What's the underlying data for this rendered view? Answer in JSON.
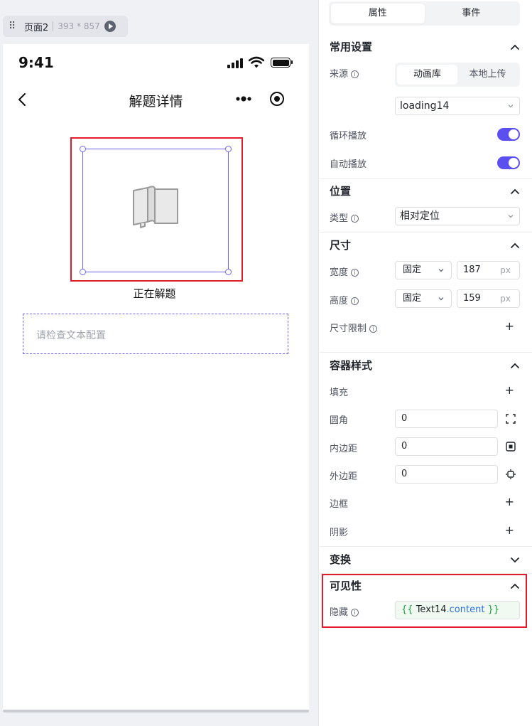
{
  "canvas": {
    "page_tag": {
      "name": "页面2",
      "size": "393 * 857"
    },
    "phone": {
      "time": "9:41",
      "nav_title": "解题详情",
      "loading_label": "正在解题",
      "text_placeholder": "请检查文本配置"
    }
  },
  "panel": {
    "tabs": [
      {
        "label": "属性",
        "active": true
      },
      {
        "label": "事件",
        "active": false
      }
    ],
    "common": {
      "title": "常用设置",
      "source_label": "来源",
      "source_options": [
        "动画库",
        "本地上传"
      ],
      "animation": "loading14",
      "loop_label": "循环播放",
      "loop_on": true,
      "autoplay_label": "自动播放",
      "autoplay_on": true
    },
    "position": {
      "title": "位置",
      "type_label": "类型",
      "type_value": "相对定位"
    },
    "size": {
      "title": "尺寸",
      "width_label": "宽度",
      "width_mode": "固定",
      "width_value": "187",
      "width_unit": "px",
      "height_label": "高度",
      "height_mode": "固定",
      "height_value": "159",
      "height_unit": "px",
      "limit_label": "尺寸限制"
    },
    "container": {
      "title": "容器样式",
      "fill_label": "填充",
      "radius_label": "圆角",
      "radius_value": "0",
      "padding_label": "内边距",
      "padding_value": "0",
      "margin_label": "外边距",
      "margin_value": "0",
      "border_label": "边框",
      "shadow_label": "阴影"
    },
    "transform": {
      "title": "变换"
    },
    "visibility": {
      "title": "可见性",
      "hide_label": "隐藏",
      "expr_open": "{{",
      "expr_object": "Text14",
      "expr_property": ".content",
      "expr_close": "}}"
    }
  },
  "colors": {
    "accent": "#5b4ff0",
    "selection_frame": "#6b63f4",
    "highlight_red": "#e11c2b",
    "expr_brace": "#1e9e43",
    "expr_property": "#2c6fe0"
  },
  "icons": [
    "drag-handle-icon",
    "play-icon",
    "signal-icon",
    "wifi-icon",
    "battery-icon",
    "back-arrow-icon",
    "more-dots-icon",
    "target-icon",
    "book-placeholder-icon",
    "info-icon",
    "chevron-up-icon",
    "chevron-down-icon",
    "plus-icon",
    "radius-icon",
    "padding-icon",
    "margin-icon"
  ]
}
